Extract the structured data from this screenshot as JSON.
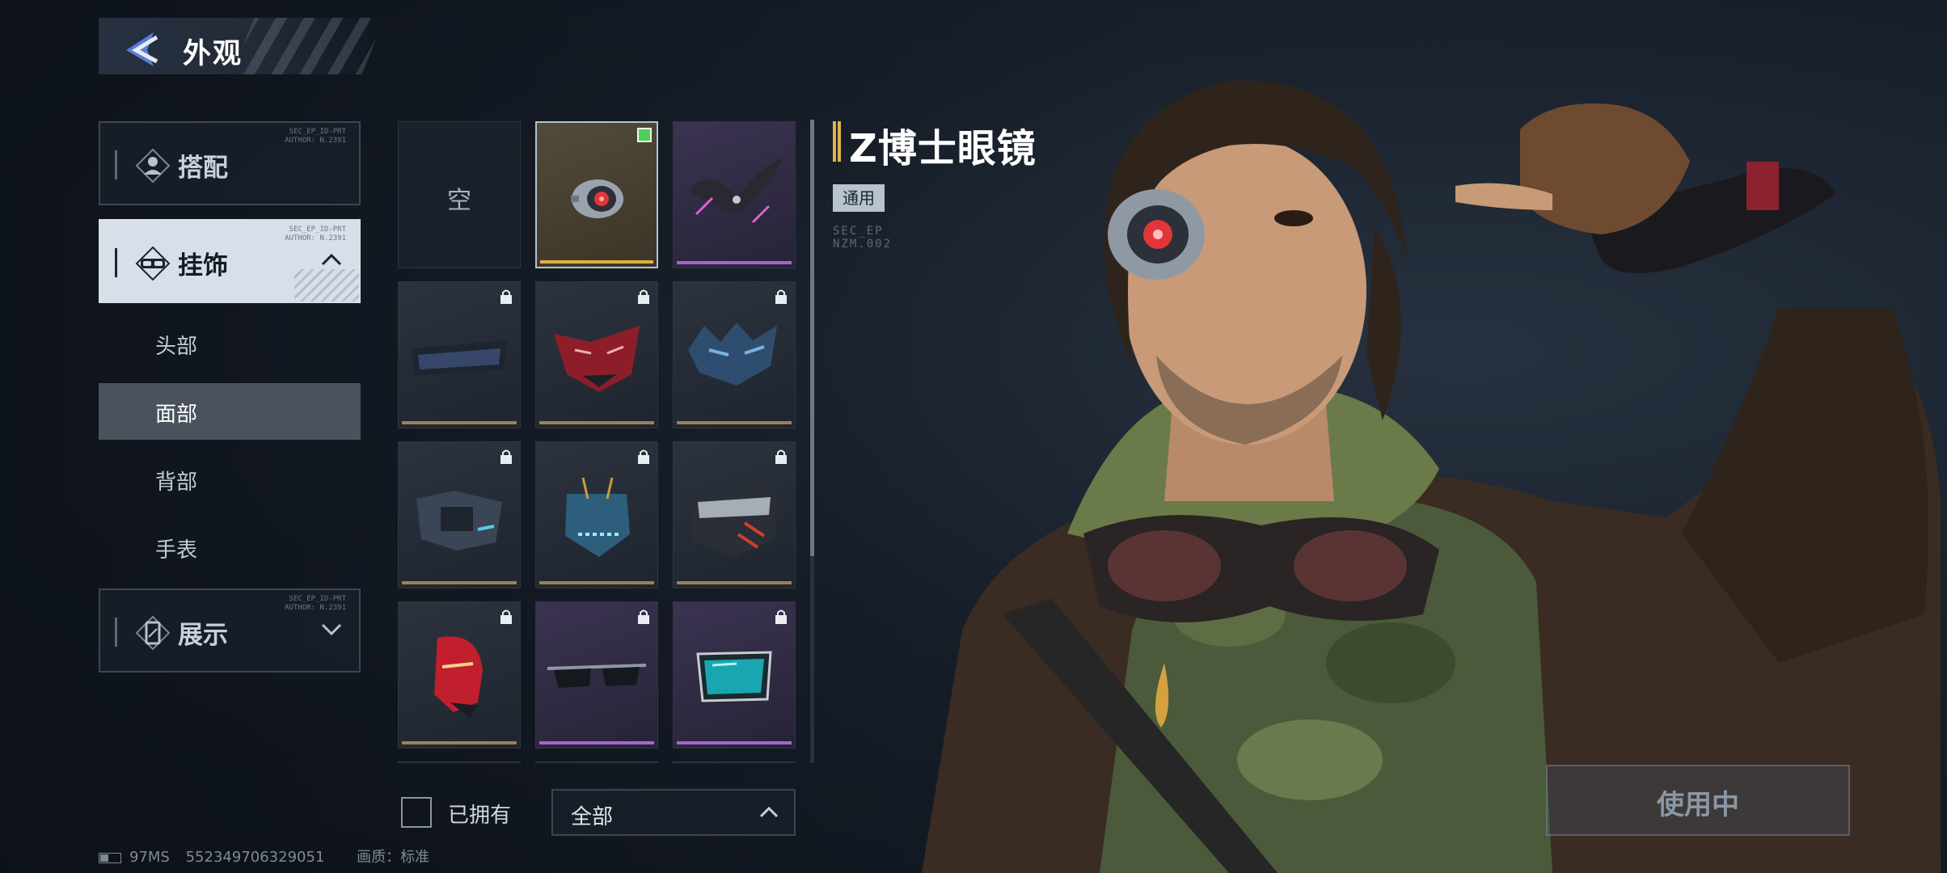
{
  "header": {
    "title": "外观"
  },
  "categories": [
    {
      "label": "搭配",
      "icon": "head-silhouette-icon",
      "meta": "SEC_EP_ID-PRT\nAUTHOR: N.2391",
      "active": false
    },
    {
      "label": "挂饰",
      "icon": "goggles-icon",
      "meta": "SEC_EP_ID-PRT\nAUTHOR: N.2391",
      "active": true
    },
    {
      "label": "展示",
      "icon": "phone-display-icon",
      "meta": "SEC_EP_ID-PRT\nAUTHOR: N.2391",
      "active": false
    }
  ],
  "subcategories": [
    {
      "label": "头部",
      "active": false
    },
    {
      "label": "面部",
      "active": true
    },
    {
      "label": "背部",
      "active": false
    },
    {
      "label": "手表",
      "active": false
    }
  ],
  "grid": {
    "empty_label": "空",
    "items": [
      {
        "name": "empty-slot",
        "rarity": "none",
        "locked": false,
        "selected": false
      },
      {
        "name": "dr-z-glasses",
        "rarity": "gold",
        "locked": false,
        "selected": true,
        "owned_check": true
      },
      {
        "name": "winged-visor",
        "rarity": "purple",
        "locked": false,
        "selected": false
      },
      {
        "name": "dark-visor",
        "rarity": "gold",
        "locked": true
      },
      {
        "name": "red-dragon-mask",
        "rarity": "gold",
        "locked": true
      },
      {
        "name": "blue-crystal-mask",
        "rarity": "gold",
        "locked": true
      },
      {
        "name": "armored-face-guard",
        "rarity": "gold",
        "locked": true
      },
      {
        "name": "blue-skull-mask",
        "rarity": "gold",
        "locked": true
      },
      {
        "name": "silver-red-mask",
        "rarity": "gold",
        "locked": true
      },
      {
        "name": "red-hood-mask",
        "rarity": "gold",
        "locked": true
      },
      {
        "name": "dark-sunglasses",
        "rarity": "purple",
        "locked": true
      },
      {
        "name": "teal-lens-glasses",
        "rarity": "purple",
        "locked": true
      }
    ]
  },
  "filters": {
    "owned_label": "已拥有",
    "dropdown_value": "全部"
  },
  "item": {
    "name": "Z博士眼镜",
    "tag": "通用",
    "code": "SEC_EP\nNZM.002"
  },
  "action": {
    "use_label": "使用中"
  },
  "status": {
    "ping": "97MS",
    "id": "552349706329051",
    "quality": "画质：标准"
  },
  "colors": {
    "gold": "#e0b040",
    "purple": "#a764d0",
    "owned": "#4fd05a"
  }
}
